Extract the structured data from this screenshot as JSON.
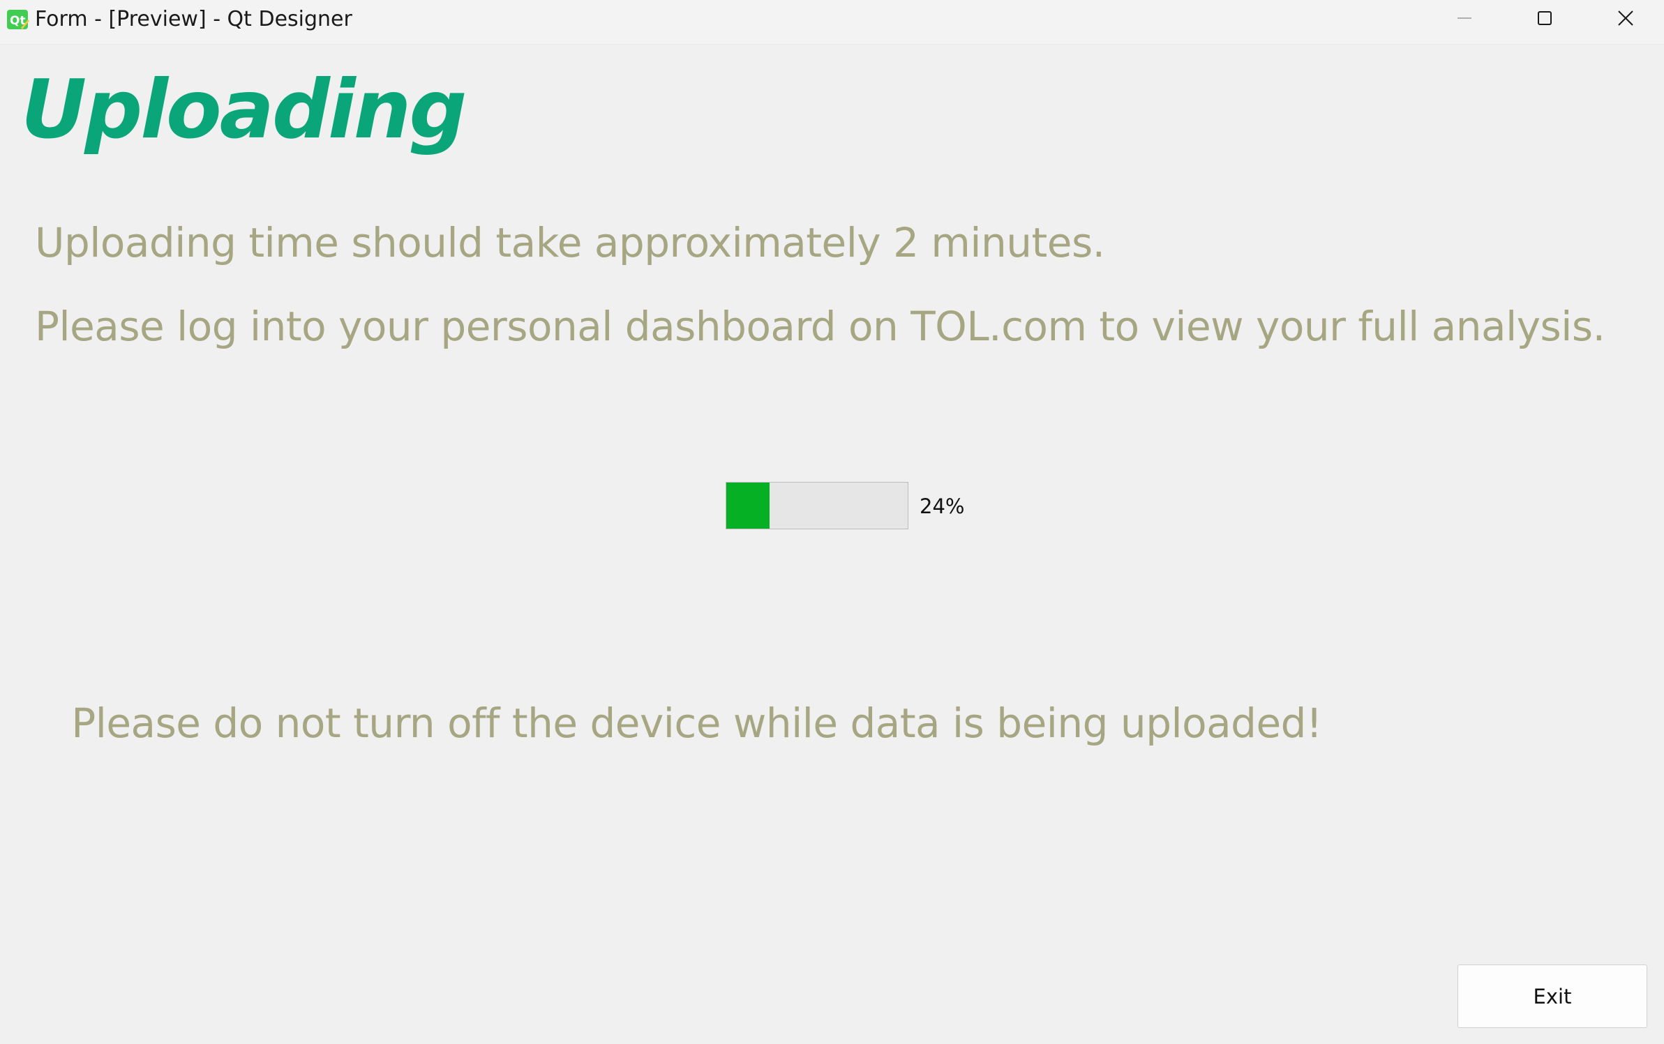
{
  "window": {
    "title": "Form - [Preview] - Qt Designer",
    "app_icon": "qt-designer-icon",
    "controls": {
      "minimize_icon": "minimize-icon",
      "maximize_icon": "maximize-icon",
      "close_icon": "close-icon"
    }
  },
  "main": {
    "heading": "Uploading",
    "info_line_1": "Uploading time should take approximately 2 minutes.",
    "info_line_2": "Please log into your personal dashboard on TOL.com to view your full analysis.",
    "progress": {
      "value_percent": 24,
      "label": "24%"
    },
    "warning": "Please do not turn off the device while data is being uploaded!",
    "exit_label": "Exit"
  },
  "colors": {
    "heading": "#0aa67a",
    "info_text": "#a6a682",
    "progress_fill": "#06b025",
    "background": "#f0f0f0"
  }
}
